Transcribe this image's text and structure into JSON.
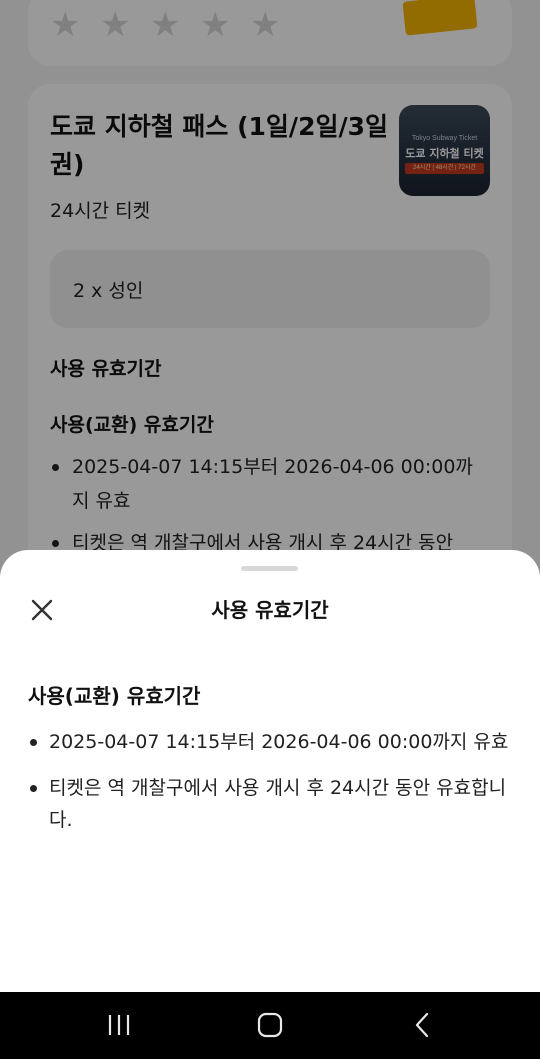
{
  "rating": {
    "stars": [
      "star-1",
      "star-2",
      "star-3",
      "star-4",
      "star-5"
    ]
  },
  "product": {
    "title": "도쿄 지하철 패스 (1일/2일/3일권)",
    "ticket_type": "24시간 티켓",
    "quantity": "2 x 성인",
    "thumbnail": {
      "small_text": "Tokyo Subway Ticket",
      "main_text": "도쿄 지하철 티켓",
      "bar_text": "24시간 | 48시간 | 72시간"
    }
  },
  "background_section": {
    "heading": "사용 유효기간",
    "subheading": "사용(교환) 유효기간",
    "bullets": [
      "2025-04-07 14:15부터 2026-04-06 00:00까지 유효",
      "티켓은 역 개찰구에서 사용 개시 후 24시간 동안"
    ]
  },
  "sheet": {
    "title": "사용 유효기간",
    "subheading": "사용(교환) 유효기간",
    "bullets": [
      "2025-04-07 14:15부터 2026-04-06 00:00까지 유효",
      "티켓은 역 개찰구에서 사용 개시 후 24시간 동안 유효합니다."
    ],
    "close_icon": "close-icon"
  },
  "navbar": {
    "recent_icon": "recent-apps-icon",
    "home_icon": "home-icon",
    "back_icon": "back-icon"
  },
  "colors": {
    "accent_yellow": "#f4b400",
    "overlay": "rgba(0,0,0,0.40)",
    "sheet_bg": "#ffffff",
    "navbar_bg": "#000000"
  }
}
